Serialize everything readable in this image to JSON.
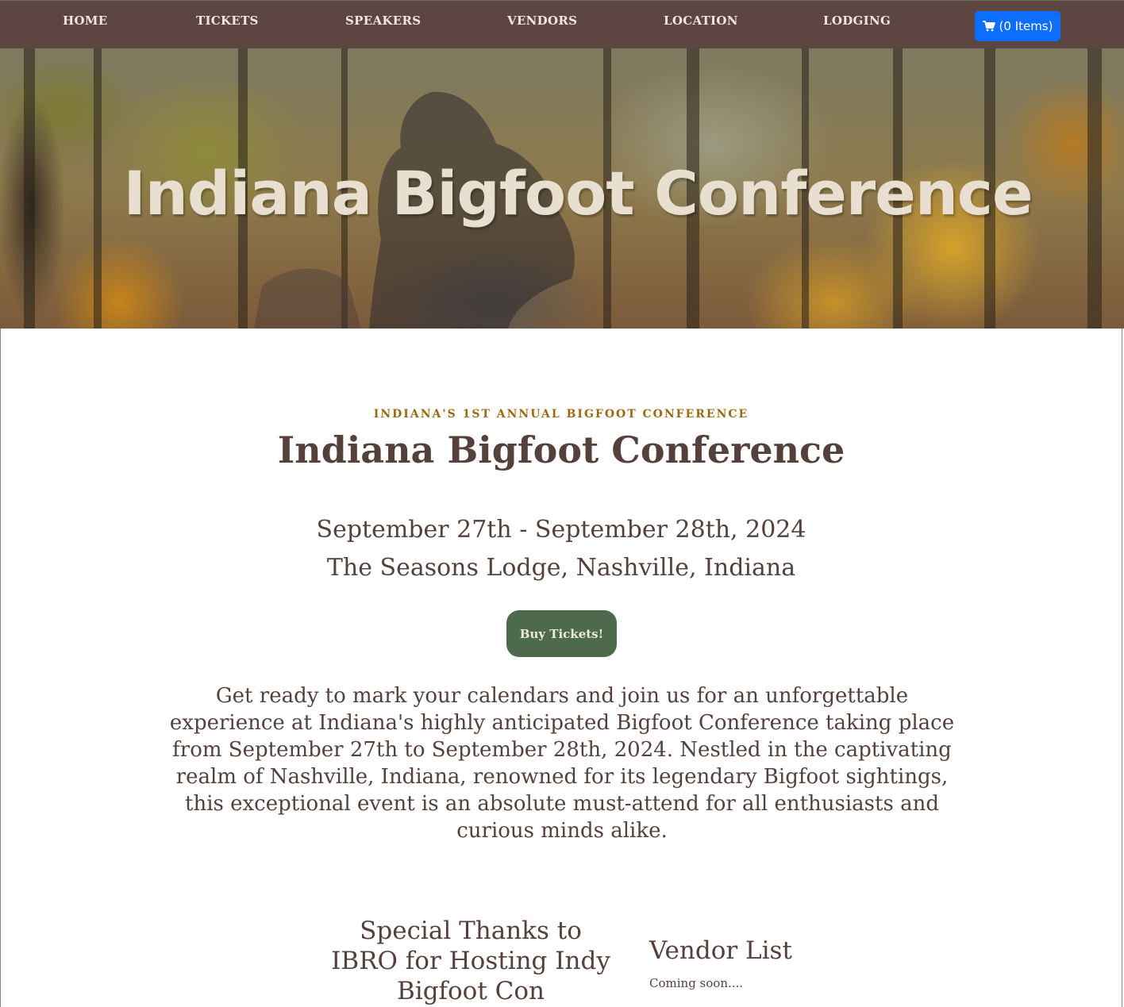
{
  "nav": {
    "items": [
      {
        "label": "HOME"
      },
      {
        "label": "TICKETS"
      },
      {
        "label": "SPEAKERS"
      },
      {
        "label": "VENDORS"
      },
      {
        "label": "LOCATION"
      },
      {
        "label": "LODGING"
      }
    ],
    "cart_label": "(0 Items)",
    "cart_icon": "shopping-cart-icon",
    "cart_color": "#0d6efd",
    "bar_color": "#5d4642"
  },
  "hero": {
    "title": "Indiana Bigfoot Conference",
    "title_color": "#e8dfd0"
  },
  "main": {
    "kicker": "INDIANA'S 1ST ANNUAL BIGFOOT CONFERENCE",
    "title": "Indiana Bigfoot Conference",
    "dates": "September 27th - September 28th, 2024",
    "venue": "The Seasons Lodge, Nashville, Indiana",
    "buy_button": "Buy Tickets!",
    "buy_button_color": "#4d6b4c",
    "intro": "Get ready to mark your calendars and join us for an unforgettable experience at Indiana's highly anticipated Bigfoot Conference taking place from September 27th to September 28th, 2024. Nestled in the captivating realm of Nashville, Indiana, renowned for its legendary Bigfoot sightings, this exceptional event is an absolute must-attend for all enthusiasts and curious minds alike."
  },
  "thanks": {
    "heading": "Special Thanks to IBRO for Hosting Indy Bigfoot Con"
  },
  "vendors": {
    "heading": "Vendor List",
    "text": "Coming soon...."
  }
}
